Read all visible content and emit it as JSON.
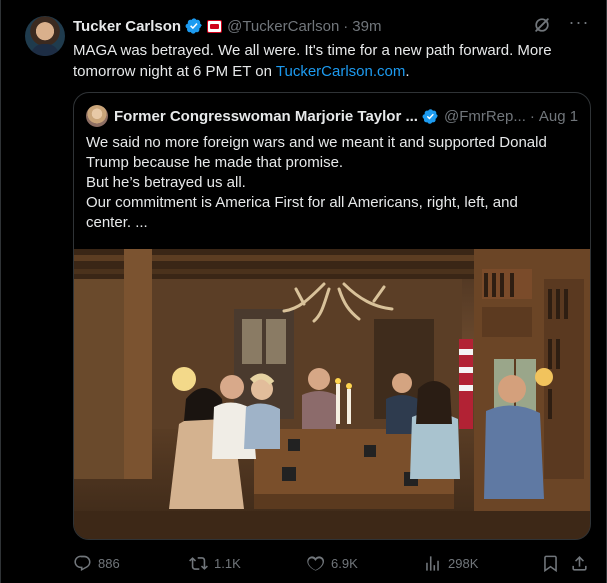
{
  "author": {
    "name": "Tucker Carlson",
    "handle": "@TuckerCarlson",
    "time": "39m"
  },
  "tweet": {
    "text_line1": "MAGA was betrayed. We all were. It's time for a new path forward. More",
    "text_line2_prefix": "tomorrow night at 6 PM ET on ",
    "link": "TuckerCarlson.com",
    "text_line2_suffix": "."
  },
  "quoted": {
    "name": "Former Congresswoman Marjorie Taylor ...",
    "handle": "@FmrRep...",
    "time": "Aug 1",
    "lines": [
      "We said no more foreign wars and we meant it and supported Donald",
      "Trump because he made that promise.",
      "But he’s betrayed us all.",
      "Our commitment is America First for all Americans, right, left, and",
      "center. ..."
    ]
  },
  "actions": {
    "replies": "886",
    "reposts": "1.1K",
    "likes": "6.9K",
    "views": "298K"
  },
  "colors": {
    "accent": "#1d9bf0",
    "muted": "#71767b",
    "text": "#e7e9ea",
    "border": "#2f3336",
    "background": "#000000"
  },
  "icons": [
    "verified-badge-icon",
    "affiliate-badge-icon",
    "grok-icon",
    "more-icon",
    "reply-icon",
    "repost-icon",
    "like-icon",
    "views-icon",
    "bookmark-icon",
    "share-icon"
  ]
}
